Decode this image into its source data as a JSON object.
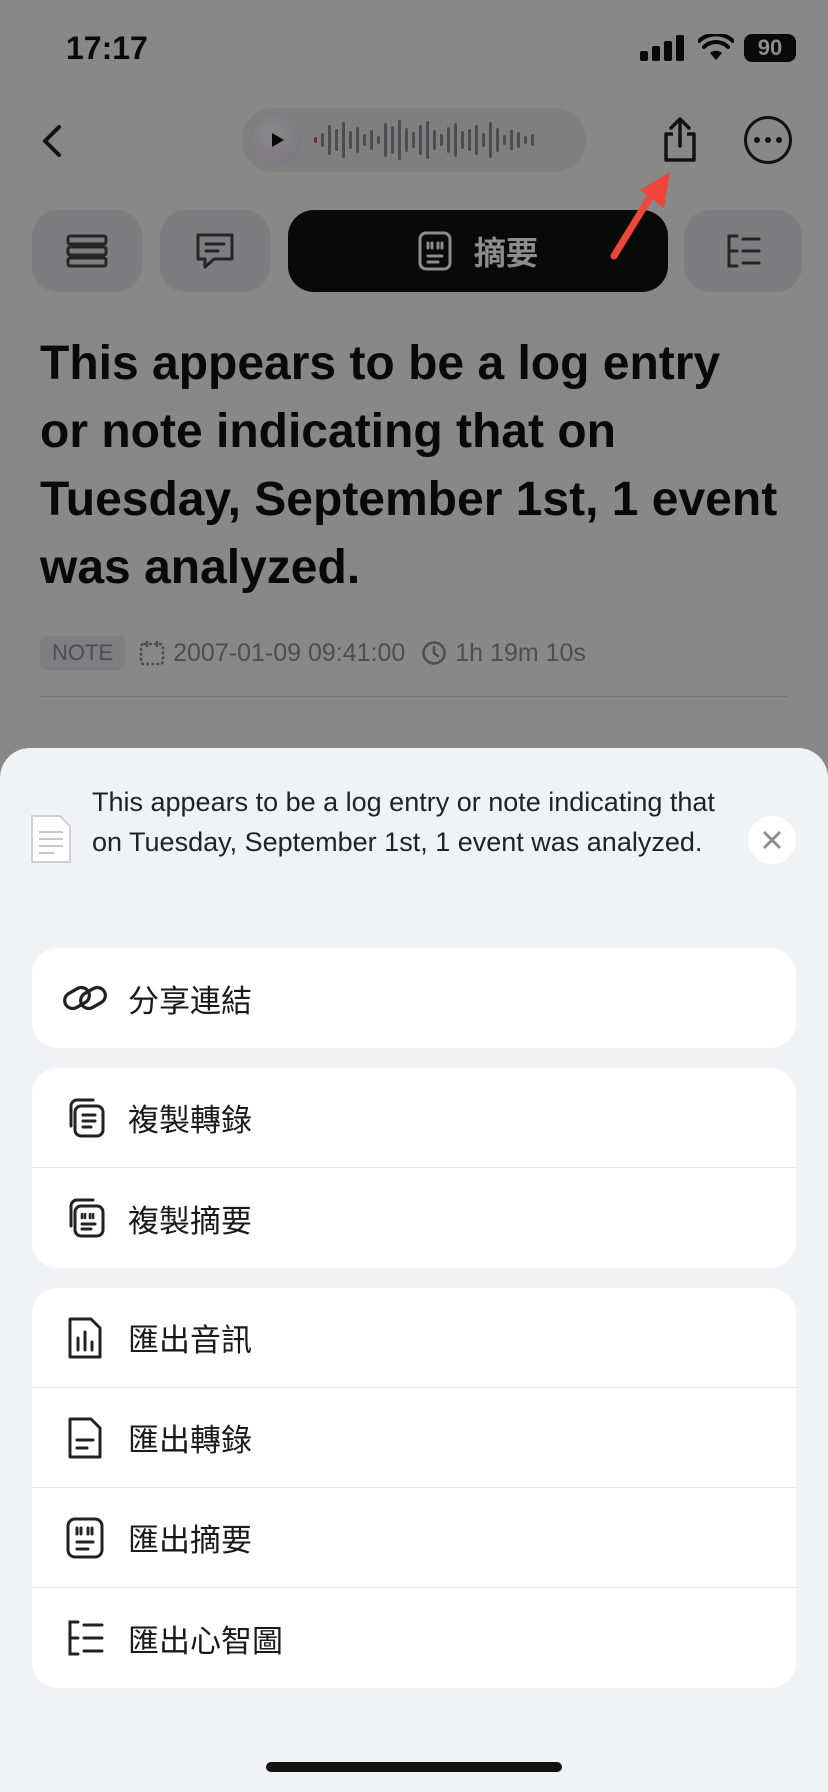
{
  "status_bar": {
    "time": "17:17",
    "battery": "90"
  },
  "tabs": [
    {
      "id": "outline",
      "icon": "list-icon",
      "label": ""
    },
    {
      "id": "chat",
      "icon": "chat-bubble-icon",
      "label": ""
    },
    {
      "id": "summary",
      "icon": "quote-doc-icon",
      "label": "摘要",
      "active": true
    },
    {
      "id": "mindmap",
      "icon": "mindmap-icon",
      "label": ""
    }
  ],
  "document": {
    "title": "This appears to be a log entry or note indicating that on Tuesday, September 1st, 1 event was analyzed.",
    "tag": "NOTE",
    "date": "2007-01-09 09:41:00",
    "duration": "1h 19m 10s"
  },
  "share_sheet": {
    "title": "This appears to be a log entry or note indicating that on Tuesday, September 1st, 1 event was analyzed.",
    "groups": [
      [
        {
          "icon": "link-icon",
          "label": "分享連結"
        }
      ],
      [
        {
          "icon": "copy-transcript-icon",
          "label": "複製轉錄"
        },
        {
          "icon": "copy-summary-icon",
          "label": "複製摘要"
        }
      ],
      [
        {
          "icon": "export-audio-icon",
          "label": "匯出音訊"
        },
        {
          "icon": "export-transcript-icon",
          "label": "匯出轉錄"
        },
        {
          "icon": "export-summary-icon",
          "label": "匯出摘要"
        },
        {
          "icon": "export-mindmap-icon",
          "label": "匯出心智圖"
        }
      ]
    ]
  },
  "colors": {
    "accent_dark": "#111111",
    "sheet_bg": "#f1f2f6",
    "annotation_arrow": "#f0453a"
  }
}
